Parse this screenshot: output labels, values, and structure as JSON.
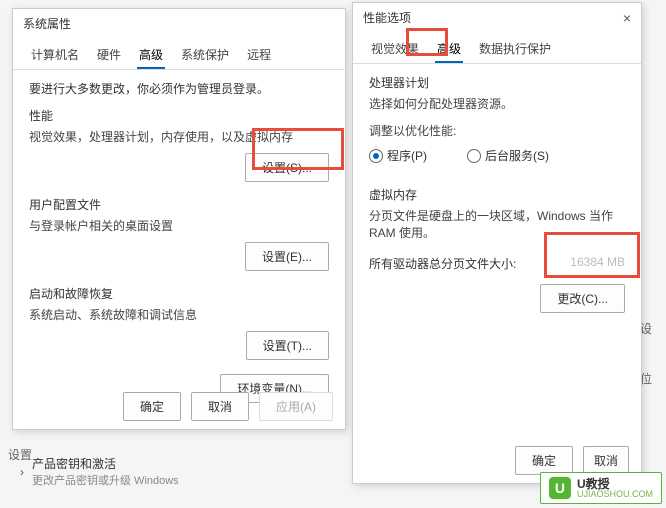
{
  "dialog1": {
    "title": "系统属性",
    "tabs": [
      "计算机名",
      "硬件",
      "高级",
      "系统保护",
      "远程"
    ],
    "active_tab": "高级",
    "note": "要进行大多数更改，你必须作为管理员登录。",
    "perf": {
      "title": "性能",
      "desc": "视觉效果，处理器计划，内存使用，以及虚拟内存",
      "btn": "设置(S)..."
    },
    "profile": {
      "title": "用户配置文件",
      "desc": "与登录帐户相关的桌面设置",
      "btn": "设置(E)..."
    },
    "startup": {
      "title": "启动和故障恢复",
      "desc": "系统启动、系统故障和调试信息",
      "btn": "设置(T)..."
    },
    "env_btn": "环境变量(N)...",
    "ok": "确定",
    "cancel": "取消",
    "apply": "应用(A)"
  },
  "dialog2": {
    "title": "性能选项",
    "tabs": [
      "视觉效果",
      "高级",
      "数据执行保护"
    ],
    "active_tab": "高级",
    "sched": {
      "title": "处理器计划",
      "desc": "选择如何分配处理器资源。",
      "adjust_label": "调整以优化性能:",
      "opt_prog": "程序(P)",
      "opt_bg": "后台服务(S)"
    },
    "vmem": {
      "title": "虚拟内存",
      "desc": "分页文件是硬盘上的一块区域，Windows 当作 RAM 使用。",
      "total_label": "所有驱动器总分页文件大小:",
      "total_value": "16384 MB",
      "btn": "更改(C)..."
    },
    "ok": "确定",
    "cancel": "取消"
  },
  "bg": {
    "settings": "设置",
    "product_title": "产品密钥和激活",
    "product_desc": "更改产品密钥或升级 Windows"
  },
  "logo": {
    "char": "U",
    "main": "U教授",
    "sub": "UJIAOSHOU.COM"
  }
}
